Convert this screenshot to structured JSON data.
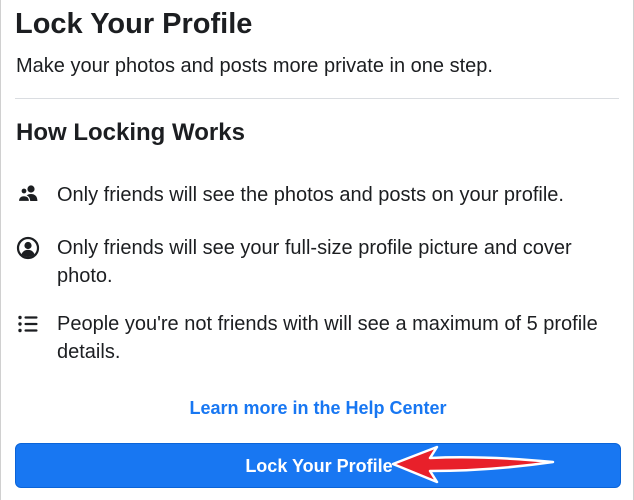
{
  "header": {
    "title": "Lock Your Profile",
    "subtitle": "Make your photos and posts more private in one step."
  },
  "section": {
    "heading": "How Locking Works",
    "items": [
      {
        "icon": "friends-icon",
        "text": "Only friends will see the photos and posts on your profile."
      },
      {
        "icon": "profile-circle-icon",
        "text": "Only friends will see your full-size profile picture and cover photo."
      },
      {
        "icon": "list-icon",
        "text": "People you're not friends with will see a maximum of 5 profile details."
      }
    ]
  },
  "help_link": "Learn more in the Help Center",
  "lock_button": {
    "label": "Lock Your Profile"
  },
  "annotation": {
    "icon": "red-arrow-icon"
  },
  "colors": {
    "accent": "#1877f2",
    "text": "#1c1e21",
    "arrow": "#e8202a",
    "divider": "#dadde1"
  }
}
